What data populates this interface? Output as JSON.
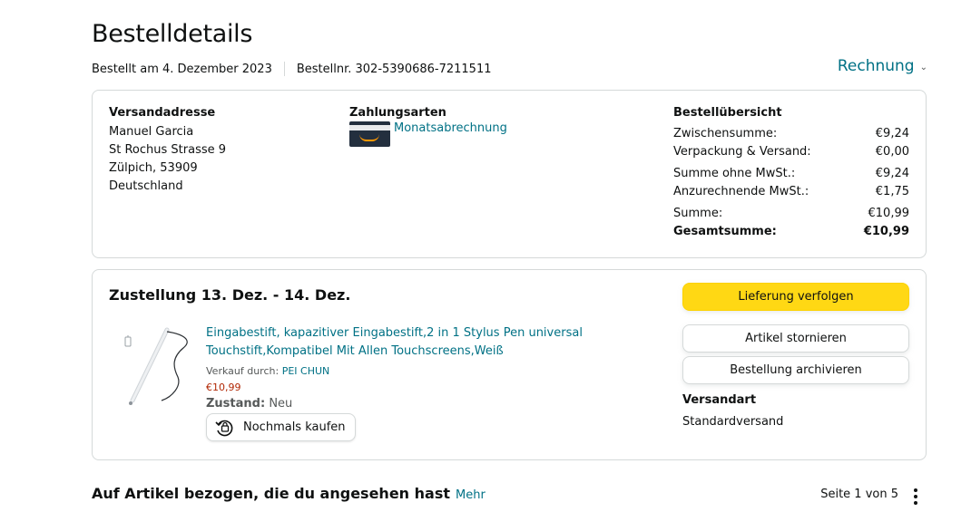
{
  "page": {
    "title": "Bestelldetails",
    "ordered_on": "Bestellt am 4. Dezember 2023",
    "order_number": "Bestellnr. 302-5390686-7211511",
    "invoice_label": "Rechnung"
  },
  "shipping_address": {
    "heading": "Versandadresse",
    "name": "Manuel Garcia",
    "street": "St Rochus Strasse 9",
    "city": "Zülpich, 53909",
    "country": "Deutschland"
  },
  "payment": {
    "heading": "Zahlungsarten",
    "method": "Monatsabrechnung",
    "icon": "amazon-card-icon"
  },
  "order_summary": {
    "heading": "Bestellübersicht",
    "rows": [
      {
        "label": "Zwischensumme:",
        "value": "€9,24"
      },
      {
        "label": "Verpackung & Versand:",
        "value": "€0,00"
      },
      {
        "label": "Summe ohne MwSt.:",
        "value": "€9,24"
      },
      {
        "label": "Anzurechnende MwSt.:",
        "value": "€1,75"
      },
      {
        "label": "Summe:",
        "value": "€10,99"
      },
      {
        "label": "Gesamtsumme:",
        "value": "€10,99"
      }
    ]
  },
  "delivery": {
    "title": "Zustellung 13. Dez. - 14. Dez.",
    "product": {
      "title": "Eingabestift, kapazitiver Eingabestift,2 in 1 Stylus Pen universal Touchstift,Kompatibel Mit Allen Touchscreens,Weiß",
      "seller_prefix": "Verkauf durch:",
      "seller": "PEI CHUN",
      "price": "€10,99",
      "condition_label": "Zustand:",
      "condition_value": "Neu",
      "buy_again_label": "Nochmals kaufen"
    },
    "buttons": {
      "track": "Lieferung verfolgen",
      "cancel": "Artikel stornieren",
      "archive": "Bestellung archivieren"
    },
    "shipping_method_heading": "Versandart",
    "shipping_method": "Standardversand"
  },
  "related": {
    "heading": "Auf Artikel bezogen, die du angesehen hast",
    "more": "Mehr",
    "pager": "Seite 1 von 5"
  },
  "colors": {
    "link": "#007185",
    "primary_button": "#ffd814",
    "price": "#b12704",
    "border": "#d5d9d9"
  }
}
